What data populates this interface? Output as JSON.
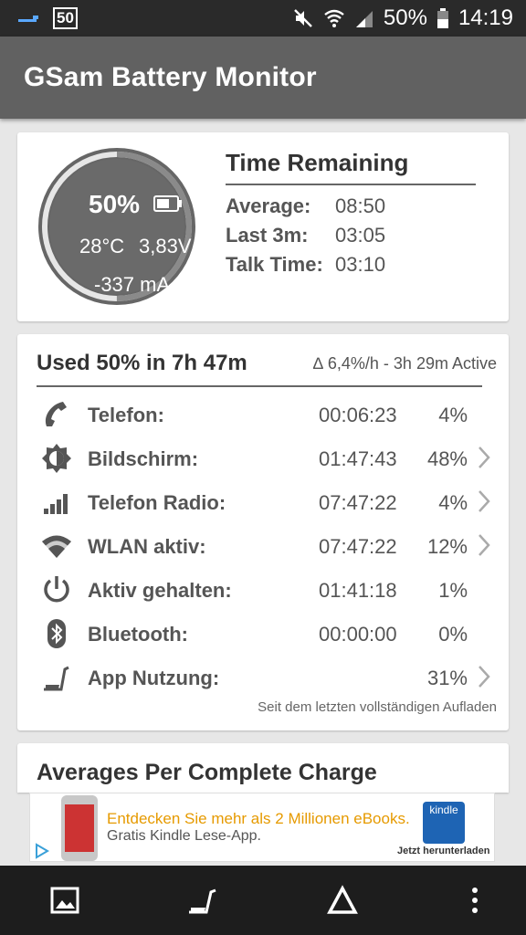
{
  "status_bar": {
    "badge": "50",
    "battery_percent": "50%",
    "time": "14:19"
  },
  "app": {
    "title": "GSam Battery Monitor"
  },
  "battery": {
    "percent": "50%",
    "temperature": "28°C",
    "voltage": "3,83V",
    "current": "-337 mA",
    "level": 0.5
  },
  "time_remaining": {
    "title": "Time Remaining",
    "rows": [
      {
        "label": "Average:",
        "value": "08:50"
      },
      {
        "label": "Last 3m:",
        "value": "03:05"
      },
      {
        "label": "Talk Time:",
        "value": "03:10"
      }
    ]
  },
  "usage": {
    "title": "Used 50% in 7h 47m",
    "rate": "∆ 6,4%/h - 3h 29m Active",
    "rows": [
      {
        "icon": "phone-icon",
        "label": "Telefon:",
        "time": "00:06:23",
        "percent": "4%"
      },
      {
        "icon": "brightness-icon",
        "label": "Bildschirm:",
        "time": "01:47:43",
        "percent": "48%"
      },
      {
        "icon": "signal-bars-icon",
        "label": "Telefon Radio:",
        "time": "07:47:22",
        "percent": "4%"
      },
      {
        "icon": "wifi-icon",
        "label": "WLAN aktiv:",
        "time": "07:47:22",
        "percent": "12%"
      },
      {
        "icon": "power-icon",
        "label": "Aktiv gehalten:",
        "time": "01:41:18",
        "percent": "1%"
      },
      {
        "icon": "bluetooth-icon",
        "label": "Bluetooth:",
        "time": "00:00:00",
        "percent": "0%"
      },
      {
        "icon": "app-usage-icon",
        "label": "App Nutzung:",
        "time": "",
        "percent": "31%"
      }
    ],
    "footnote": "Seit dem letzten vollständigen Aufladen"
  },
  "averages": {
    "title": "Averages Per Complete Charge"
  },
  "ad": {
    "line1": "Entdecken Sie mehr als 2 Millionen eBooks.",
    "line2": "Gratis Kindle Lese-App.",
    "brand": "kindle",
    "cta": "Jetzt herunterladen"
  },
  "bottom_nav": [
    "image-icon",
    "app-usage-icon",
    "delta-icon",
    "more-vertical-icon"
  ]
}
